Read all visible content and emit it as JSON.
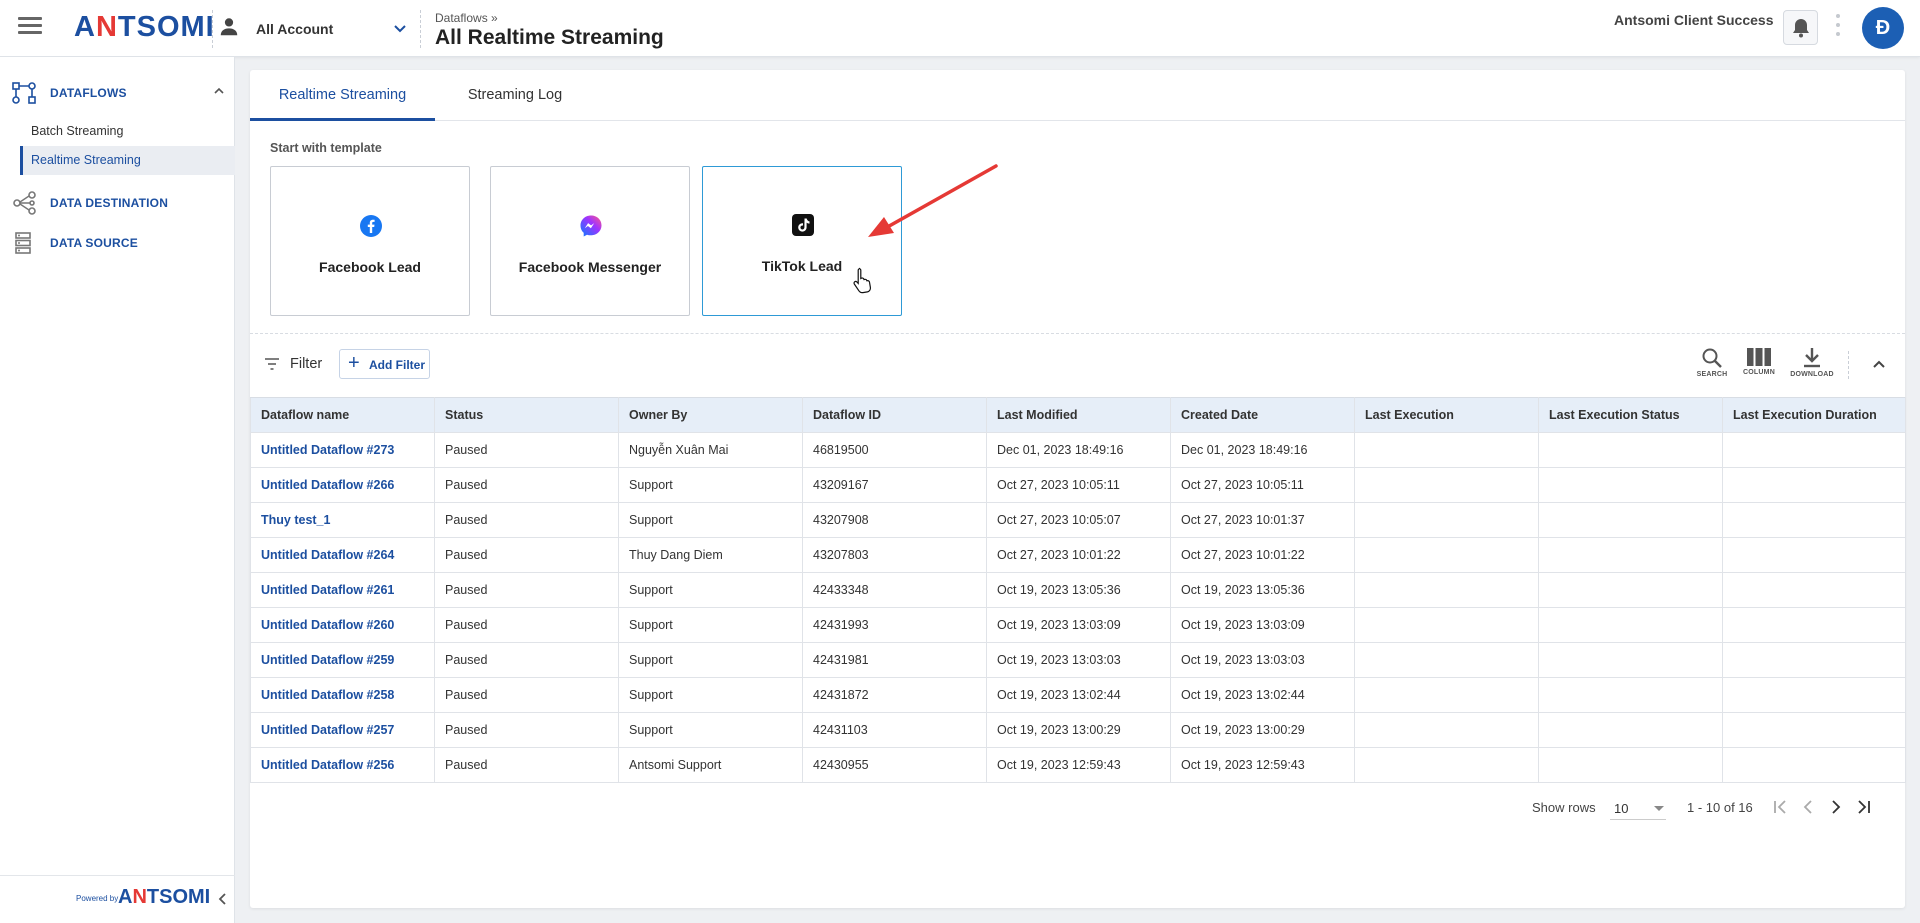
{
  "header": {
    "logo": {
      "prefix": "A",
      "highlight": "N",
      "rest": "TSOMI"
    },
    "account_label": "All Account",
    "breadcrumb": "Dataflows »",
    "page_title": "All Realtime Streaming",
    "user_name": "Antsomi Client Success",
    "avatar_initial": "Đ"
  },
  "sidebar": {
    "sections": [
      {
        "label": "DATAFLOWS",
        "icon": "dataflow-icon"
      },
      {
        "label": "DATA DESTINATION",
        "icon": "share-nodes-icon"
      },
      {
        "label": "DATA SOURCE",
        "icon": "database-icon"
      }
    ],
    "sub_items": [
      {
        "label": "Batch Streaming"
      },
      {
        "label": "Realtime Streaming"
      }
    ],
    "footer": {
      "powered_by": "Powered by",
      "logo_prefix": "A",
      "logo_highlight": "N",
      "logo_rest": "TSOMI"
    }
  },
  "tabs": [
    {
      "label": "Realtime Streaming"
    },
    {
      "label": "Streaming Log"
    }
  ],
  "templates": {
    "title": "Start with template",
    "items": [
      {
        "name": "Facebook Lead",
        "icon": "facebook-icon"
      },
      {
        "name": "Facebook Messenger",
        "icon": "messenger-icon"
      },
      {
        "name": "TikTok Lead",
        "icon": "tiktok-icon"
      }
    ]
  },
  "toolbar": {
    "filter_label": "Filter",
    "add_filter_label": "Add Filter",
    "search_label": "SEARCH",
    "column_label": "COLUMN",
    "download_label": "DOWNLOAD"
  },
  "table": {
    "columns": [
      "Dataflow name",
      "Status",
      "Owner By",
      "Dataflow ID",
      "Last Modified",
      "Created Date",
      "Last Execution",
      "Last Execution Status",
      "Last Execution Duration"
    ],
    "rows": [
      [
        "Untitled Dataflow #273",
        "Paused",
        "Nguyễn Xuân Mai",
        "46819500",
        "Dec 01, 2023 18:49:16",
        "Dec 01, 2023 18:49:16",
        "",
        "",
        ""
      ],
      [
        "Untitled Dataflow #266",
        "Paused",
        "Support",
        "43209167",
        "Oct 27, 2023 10:05:11",
        "Oct 27, 2023 10:05:11",
        "",
        "",
        ""
      ],
      [
        "Thuy test_1",
        "Paused",
        "Support",
        "43207908",
        "Oct 27, 2023 10:05:07",
        "Oct 27, 2023 10:01:37",
        "",
        "",
        ""
      ],
      [
        "Untitled Dataflow #264",
        "Paused",
        "Thuy Dang Diem",
        "43207803",
        "Oct 27, 2023 10:01:22",
        "Oct 27, 2023 10:01:22",
        "",
        "",
        ""
      ],
      [
        "Untitled Dataflow #261",
        "Paused",
        "Support",
        "42433348",
        "Oct 19, 2023 13:05:36",
        "Oct 19, 2023 13:05:36",
        "",
        "",
        ""
      ],
      [
        "Untitled Dataflow #260",
        "Paused",
        "Support",
        "42431993",
        "Oct 19, 2023 13:03:09",
        "Oct 19, 2023 13:03:09",
        "",
        "",
        ""
      ],
      [
        "Untitled Dataflow #259",
        "Paused",
        "Support",
        "42431981",
        "Oct 19, 2023 13:03:03",
        "Oct 19, 2023 13:03:03",
        "",
        "",
        ""
      ],
      [
        "Untitled Dataflow #258",
        "Paused",
        "Support",
        "42431872",
        "Oct 19, 2023 13:02:44",
        "Oct 19, 2023 13:02:44",
        "",
        "",
        ""
      ],
      [
        "Untitled Dataflow #257",
        "Paused",
        "Support",
        "42431103",
        "Oct 19, 2023 13:00:29",
        "Oct 19, 2023 13:00:29",
        "",
        "",
        ""
      ],
      [
        "Untitled Dataflow #256",
        "Paused",
        "Antsomi Support",
        "42430955",
        "Oct 19, 2023 12:59:43",
        "Oct 19, 2023 12:59:43",
        "",
        "",
        ""
      ]
    ]
  },
  "pagination": {
    "show_rows_label": "Show rows",
    "rows_per_page": "10",
    "range_text": "1 - 10 of 16"
  },
  "colors": {
    "brand_blue": "#1c4fa0",
    "brand_red": "#e53935",
    "facebook_blue": "#1877f2",
    "selected_border": "#2e9ad6",
    "annotation_arrow": "#e53935"
  }
}
